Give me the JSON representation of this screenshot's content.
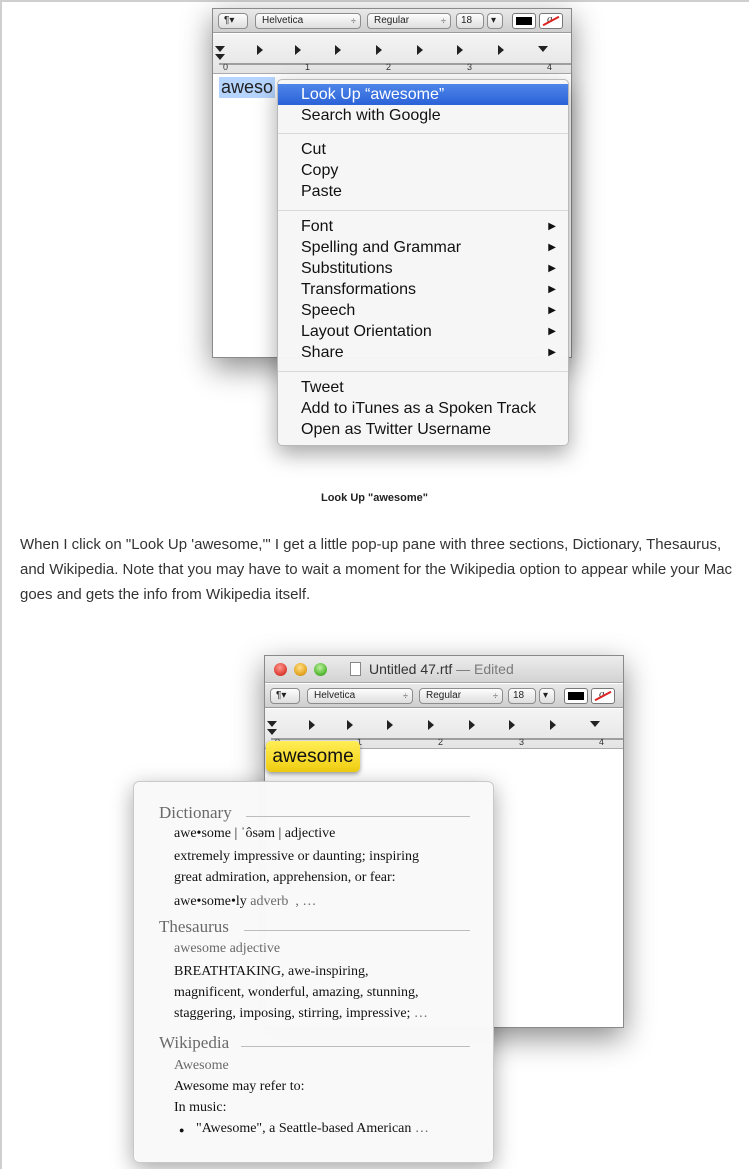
{
  "toolbar": {
    "para_button": "¶▾",
    "font_family": "Helvetica",
    "font_style": "Regular",
    "font_size": "18",
    "stepper_glyph": "÷",
    "dropdown_glyph": "▾",
    "no_color_glyph": "a"
  },
  "ruler": {
    "marks": [
      "0",
      "1",
      "2",
      "3",
      "4"
    ]
  },
  "doc1": {
    "selected_text": "aweso"
  },
  "context_menu": {
    "group1": [
      "Look Up “awesome”",
      "Search with Google"
    ],
    "group2": [
      "Cut",
      "Copy",
      "Paste"
    ],
    "group3": [
      "Font",
      "Spelling and Grammar",
      "Substitutions",
      "Transformations",
      "Speech",
      "Layout Orientation",
      "Share"
    ],
    "group4": [
      "Tweet",
      "Add to iTunes as a Spoken Track",
      "Open as Twitter Username"
    ],
    "submenu_arrow": "▶"
  },
  "caption": "Look Up \"awesome\"",
  "paragraph": "When I click on \"Look Up 'awesome,'\" I get a little pop-up pane with three sections, Dictionary, Thesaurus, and Wikipedia. Note that you may have to wait a moment for the Wikipedia option to appear while your Mac goes and gets the info from Wikipedia itself.",
  "window2": {
    "title": "Untitled 47.rtf",
    "edited": "— Edited",
    "highlighted_word": "awesome"
  },
  "dictionary_panel": {
    "dictionary": {
      "heading": "Dictionary",
      "pronunciation": "awe•some | ˈôsəm | adjective",
      "definition_line1": "extremely impressive or daunting; inspiring",
      "definition_line2": "great admiration, apprehension, or fear:",
      "derivative_word": "awe•some•ly",
      "derivative_pos": "adverb",
      "derivative_more": ", …"
    },
    "thesaurus": {
      "heading": "Thesaurus",
      "headword": "awesome adjective",
      "line1": "BREATHTAKING, awe-inspiring,",
      "line2": "magnificent, wonderful, amazing, stunning,",
      "line3": "staggering, imposing, stirring, impressive;",
      "line3_more": "…"
    },
    "wikipedia": {
      "heading": "Wikipedia",
      "title": "Awesome",
      "line1": "Awesome may refer to:",
      "line2": "In music:",
      "bullet_glyph": "●",
      "bullet_text": "\"Awesome\", a Seattle-based American",
      "bullet_more": "…"
    }
  }
}
